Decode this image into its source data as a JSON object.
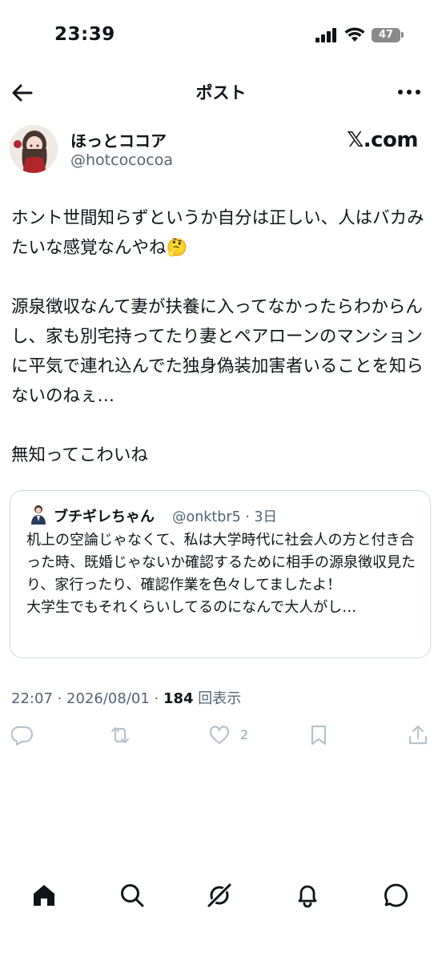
{
  "status_bar": {
    "time": "23:39",
    "battery": "47"
  },
  "header": {
    "title": "ポスト"
  },
  "author": {
    "name": "ほっとココア",
    "handle": "@hotcococoa"
  },
  "brand": {
    "label": "𝕏.com"
  },
  "post": {
    "text": "ホント世間知らずというか自分は正しい、人はバカみたいな感覚なんやね🤔\n\n源泉徴収なんて妻が扶養に入ってなかったらわからんし、家も別宅持ってたり妻とペアローンのマンションに平気で連れ込んでた独身偽装加害者いることを知らないのねぇ…\n\n無知ってこわいね"
  },
  "quote": {
    "name": "ブチギレちゃん",
    "meta": "@onktbr5 · 3日",
    "text": "机上の空論じゃなくて、私は大学時代に社会人の方と付き合った時、既婚じゃないか確認するために相手の源泉徴収見たり、家行ったり、確認作業を色々してましたよ！\n大学生でもそれくらいしてるのになんで大人がし…"
  },
  "meta": {
    "time_date": "22:07 · 2026/08/01 · ",
    "views": "184",
    "views_label": " 回表示"
  },
  "actions": {
    "like_count": "2"
  },
  "colors": {
    "text": "#0f1419",
    "secondary": "#536471",
    "border": "#cfd9de"
  },
  "icons": [
    "back-arrow-icon",
    "more-icon",
    "reply-icon",
    "repost-icon",
    "like-icon",
    "bookmark-icon",
    "share-icon",
    "home-icon",
    "search-icon",
    "grok-icon",
    "notifications-icon",
    "messages-icon"
  ]
}
